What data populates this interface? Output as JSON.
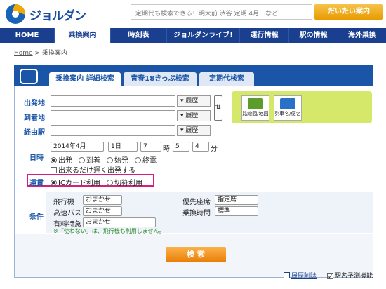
{
  "brand": {
    "logo_text": "ジョルダン"
  },
  "search": {
    "placeholder": "定期代も検索できる！明大前 渋谷 定期 4月…など",
    "button_label": "だいたい案内"
  },
  "nav": {
    "items": [
      "HOME",
      "乗換案内",
      "時刻表",
      "ジョルダンライブ!",
      "運行情報",
      "駅の情報",
      "海外乗換"
    ],
    "active_index": 1
  },
  "breadcrumb": {
    "home": "Home",
    "separator": ">",
    "current": "乗換案内"
  },
  "tabs": [
    "乗換案内 詳細検索",
    "青春18きっぷ検索",
    "定期代検索"
  ],
  "form": {
    "from_label": "出発地",
    "to_label": "到着地",
    "via_label": "経由駅",
    "history_label": "履歴",
    "swap_symbol": "⇅",
    "map_button": "路線図/地図",
    "train_button": "列車名/便名",
    "date_label": "日時",
    "date": {
      "year_month": "2014年4月",
      "day": "1日",
      "hour": "7",
      "hour_unit": "時",
      "min_tens": "5",
      "min_ones": "4",
      "min_unit": "分"
    },
    "time_options": [
      "出発",
      "到着",
      "始発",
      "終電"
    ],
    "time_selected": "出発",
    "late_departure": "出来るだけ遅く出発する",
    "fare_label": "運賃",
    "fare_options": [
      "ICカード利用",
      "切符利用"
    ],
    "fare_selected": "ICカード利用",
    "conditions_label": "条件",
    "conditions": [
      {
        "label": "飛行機",
        "value": "おまかせ"
      },
      {
        "label": "高速バス",
        "value": "おまかせ"
      },
      {
        "label": "有料特急",
        "value": "おまかせ"
      },
      {
        "label": "優先座席",
        "value": "指定席"
      },
      {
        "label": "乗換時間",
        "value": "標準"
      }
    ],
    "conditions_note": "※「使わない」は、飛行機も利用しません。",
    "search_button": "検 索",
    "history_delete": "履歴削除",
    "station_predict": "駅名予測機能"
  },
  "colors": {
    "nav_bg": "#1a3f8f",
    "accent_orange": "#e97d05",
    "highlight_magenta": "#d61f7b",
    "green_panel": "#d6e86a"
  }
}
